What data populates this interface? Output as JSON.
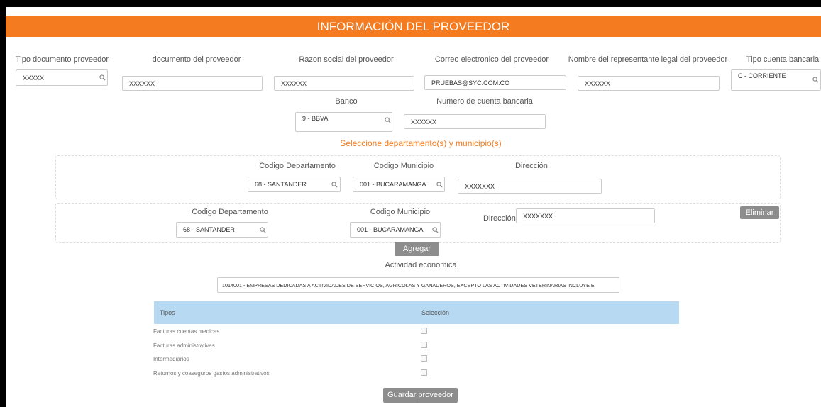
{
  "header": {
    "title": "INFORMACIÓN DEL PROVEEDOR"
  },
  "provider": {
    "tipo_documento": {
      "label": "Tipo documento proveedor",
      "value": "XXXXX"
    },
    "documento": {
      "label": "documento del proveedor",
      "value": "XXXXXX"
    },
    "razon_social": {
      "label": "Razon social del proveedor",
      "value": "XXXXXX"
    },
    "correo": {
      "label": "Correo electronico del proveedor",
      "value": "PRUEBAS@SYC.COM.CO"
    },
    "representante": {
      "label": "Nombre del representante legal del proveedor",
      "value": "XXXXXX"
    },
    "tipo_cuenta": {
      "label": "Tipo cuenta bancaria",
      "value": "C - CORRIENTE"
    },
    "banco": {
      "label": "Banco",
      "value": "9 - BBVA"
    },
    "numero_cuenta": {
      "label": "Numero de cuenta bancaria",
      "value": "XXXXXX"
    }
  },
  "location": {
    "prompt": "Seleccione departamento(s) y municipio(s)",
    "rows": [
      {
        "dep_label": "Codigo Departamento",
        "dep_value": "68 - SANTANDER",
        "mun_label": "Codigo Municipio",
        "mun_value": "001 - BUCARAMANGA",
        "dir_label": "Dirección",
        "dir_value": "XXXXXXX"
      },
      {
        "dep_label": "Codigo Departamento",
        "dep_value": "68 - SANTANDER",
        "mun_label": "Codigo Municipio",
        "mun_value": "001 - BUCARAMANGA",
        "dir_label": "Dirección",
        "dir_value": "XXXXXXX",
        "delete_label": "Eliminar"
      }
    ],
    "add_label": "Agregar"
  },
  "actividad": {
    "label": "Actividad economica",
    "value": "1014001 - EMPRESAS DEDICADAS A ACTIVIDADES DE SERVICIOS, AGRICOLAS Y GANADEROS, EXCEPTO LAS ACTIVIDADES VETERINARIAS INCLUYE E"
  },
  "types_table": {
    "col_tipos": "Tipos",
    "col_seleccion": "Selección",
    "rows": [
      {
        "label": "Facturas cuentas medicas",
        "checked": false
      },
      {
        "label": "Facturas administrativas",
        "checked": false
      },
      {
        "label": "Intermediarios",
        "checked": false
      },
      {
        "label": "Retornos y coaseguros gastos administrativos",
        "checked": false
      }
    ]
  },
  "save_label": "Guardar proveedor",
  "colors": {
    "accent": "#f47b20",
    "table_header": "#b8d9f2",
    "button": "#8d8d8d"
  },
  "icons": {
    "lookup": "search-icon"
  }
}
